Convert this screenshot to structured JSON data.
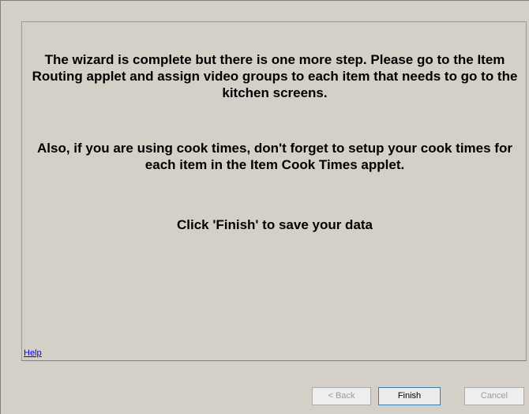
{
  "wizard": {
    "messages": {
      "line1": "The wizard is complete but there is one more step. Please go to the Item Routing applet and assign video groups to each item that needs to go to the kitchen screens.",
      "line2": "Also, if you are using cook times, don't forget to setup your cook times for each item in the Item Cook Times applet.",
      "line3": "Click 'Finish' to save your data"
    },
    "help_link": "Help",
    "buttons": {
      "back": "< Back",
      "finish": "Finish",
      "cancel": "Cancel"
    },
    "button_states": {
      "back_enabled": false,
      "finish_enabled": true,
      "cancel_enabled": false
    }
  },
  "colors": {
    "background": "#d4d0c8",
    "link": "#0000ee",
    "text": "#000000",
    "disabled_text": "#9a9a9a",
    "focus_border": "#3c7fb1"
  }
}
